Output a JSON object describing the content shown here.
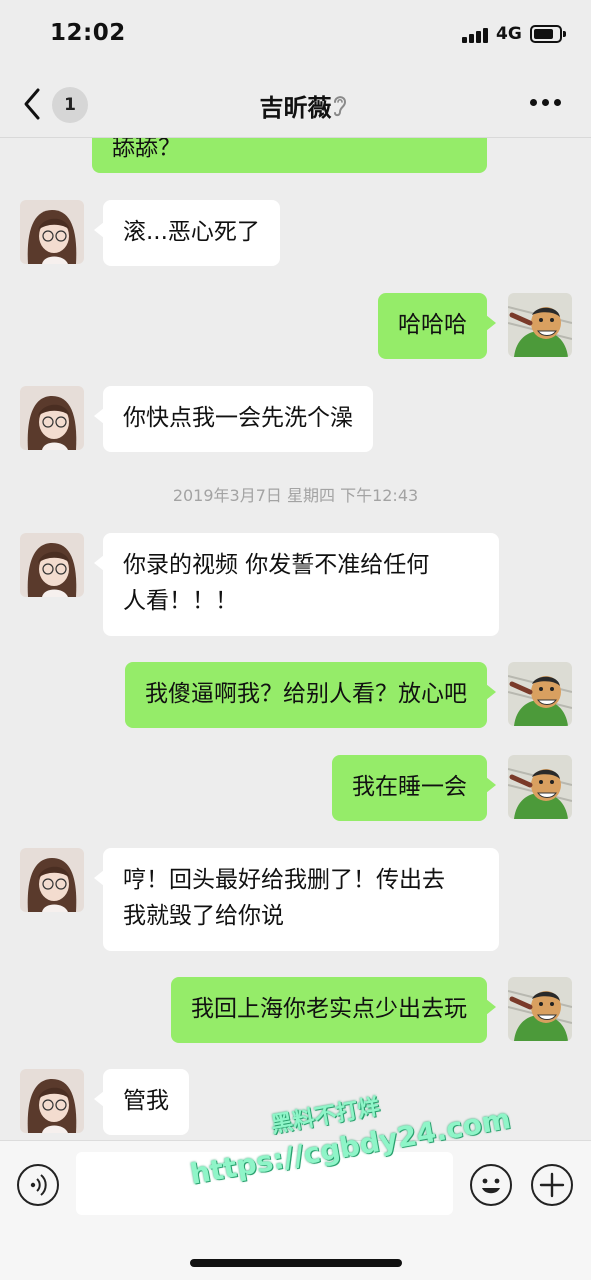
{
  "status_bar": {
    "time": "12:02",
    "network": "4G"
  },
  "header": {
    "back_badge": "1",
    "title": "吉昕薇"
  },
  "messages": [
    {
      "side": "out",
      "text": "舔舔？"
    },
    {
      "side": "in",
      "text": "滚...恶心死了"
    },
    {
      "side": "out",
      "text": "哈哈哈"
    },
    {
      "side": "in",
      "text": "你快点我一会先洗个澡"
    },
    {
      "side": "in",
      "text": "你录的视频 你发誓不准给任何\n人看！！！"
    },
    {
      "side": "out",
      "text": "我傻逼啊我？给别人看？放心吧"
    },
    {
      "side": "out",
      "text": "我在睡一会"
    },
    {
      "side": "in",
      "text": "哼！回头最好给我删了！传出去\n我就毁了给你说"
    },
    {
      "side": "out",
      "text": "我回上海你老实点少出去玩"
    },
    {
      "side": "in",
      "text": "管我"
    }
  ],
  "timestamp": "2019年3月7日 星期四 下午12:43",
  "watermark": {
    "line1": "黑料不打烊",
    "line2": "https://cgbdy24.com"
  },
  "colors": {
    "background": "#ededed",
    "outgoing_bubble": "#95ec69",
    "incoming_bubble": "#ffffff"
  },
  "icons": {
    "back": "chevron-left-icon",
    "ear": "ear-icon",
    "more": "more-dots-icon",
    "voice": "voice-icon",
    "emoji": "emoji-icon",
    "plus": "plus-icon"
  }
}
